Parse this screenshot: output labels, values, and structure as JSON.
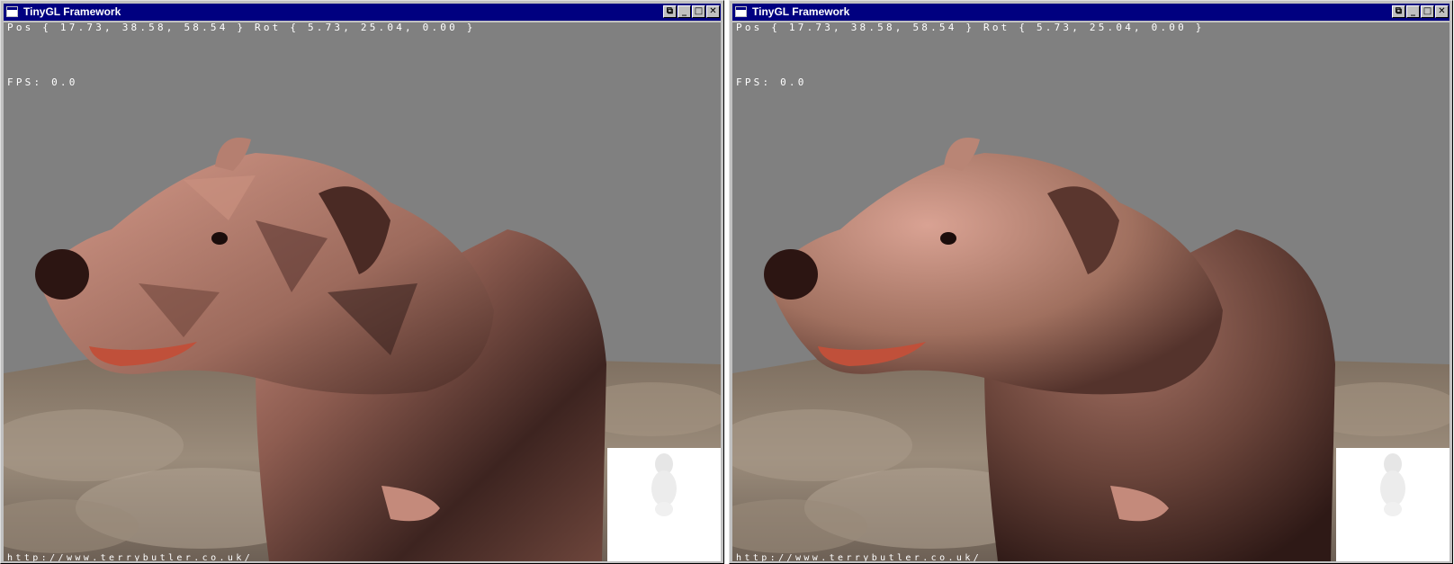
{
  "windows": [
    {
      "title": "TinyGL Framework",
      "controls": {
        "restore_glyph": "⧉",
        "minimize_glyph": "_",
        "maximize_glyph": "□",
        "close_glyph": "✕"
      },
      "hud": {
        "pos": "Pos { 17.73, 38.58, 58.54 } Rot { 5.73, 25.04, 0.00 }",
        "fps": "FPS: 0.0",
        "url": "http://www.terrybutler.co.uk/"
      },
      "shading": "flat"
    },
    {
      "title": "TinyGL Framework",
      "controls": {
        "restore_glyph": "⧉",
        "minimize_glyph": "_",
        "maximize_glyph": "□",
        "close_glyph": "✕"
      },
      "hud": {
        "pos": "Pos { 17.73, 38.58, 58.54 } Rot { 5.73, 25.04, 0.00 }",
        "fps": "FPS: 0.0",
        "url": "http://www.terrybutler.co.uk/"
      },
      "shading": "smooth"
    }
  ],
  "colors": {
    "title_bar": "#000080",
    "window_frame": "#c0c0c0",
    "viewport_background": "#808080",
    "hud_text": "#ffffff",
    "bear_fur": "#8a5a4e",
    "bear_fur_dark": "#2b1512",
    "ground_rock": "#8d7d6c"
  }
}
